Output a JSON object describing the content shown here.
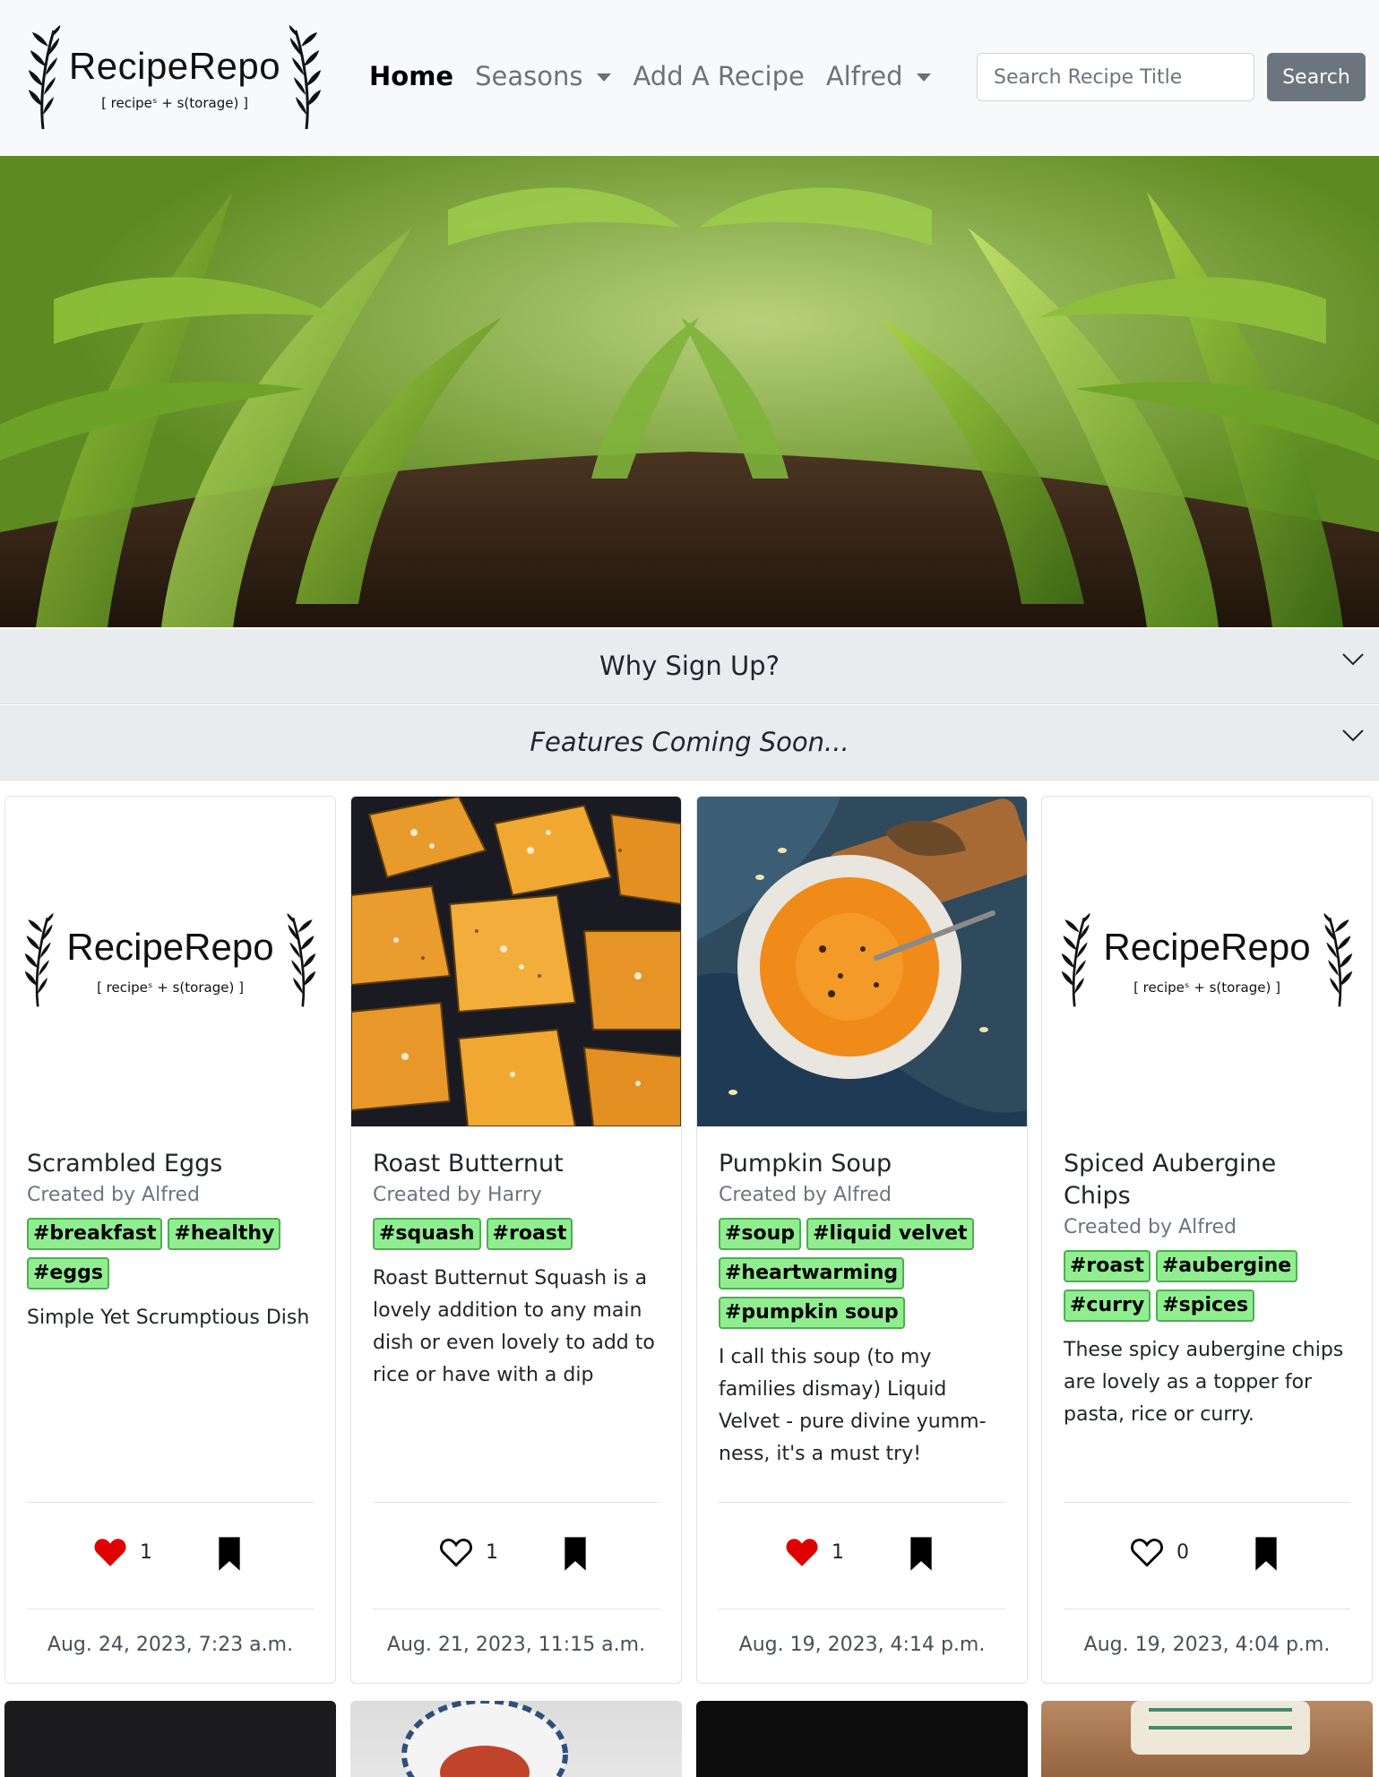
{
  "navbar": {
    "brand_title": "RecipeRepo",
    "brand_subtitle": "[ recipeˢ + s(torage) ]",
    "links": [
      {
        "label": "Home",
        "active": true
      },
      {
        "label": "Seasons",
        "dropdown": true
      },
      {
        "label": "Add A Recipe"
      },
      {
        "label": "Alfred",
        "dropdown": true
      }
    ],
    "search_placeholder": "Search Recipe Title",
    "search_button": "Search"
  },
  "accordion": [
    {
      "title": "Why Sign Up?"
    },
    {
      "title": "Features Coming Soon..."
    }
  ],
  "cards": [
    {
      "title": "Scrambled Eggs",
      "author": "Created by Alfred",
      "tags": [
        "#breakfast",
        "#healthy",
        "#eggs"
      ],
      "description": "Simple Yet Scrumptious Dish",
      "likes": "1",
      "liked": true,
      "date": "Aug. 24, 2023, 7:23 a.m.",
      "image": "logo-placeholder"
    },
    {
      "title": "Roast Butternut",
      "author": "Created by Harry",
      "tags": [
        "#squash",
        "#roast"
      ],
      "description": "Roast Butternut Squash is a lovely addition to any main dish or even lovely to add to rice or have with a dip",
      "likes": "1",
      "liked": false,
      "date": "Aug. 21, 2023, 11:15 a.m.",
      "image": "roast-butternut-photo"
    },
    {
      "title": "Pumpkin Soup",
      "author": "Created by Alfred",
      "tags": [
        "#soup",
        "#liquid velvet",
        "#heartwarming",
        "#pumpkin soup"
      ],
      "description": "I call this soup (to my families dismay) Liquid Velvet - pure divine yumm-ness, it's a must try!",
      "likes": "1",
      "liked": true,
      "date": "Aug. 19, 2023, 4:14 p.m.",
      "image": "pumpkin-soup-photo"
    },
    {
      "title": "Spiced Aubergine Chips",
      "author": "Created by Alfred",
      "tags": [
        "#roast",
        "#aubergine",
        "#curry",
        "#spices"
      ],
      "description": "These spicy aubergine chips are lovely as a topper for pasta, rice or curry.",
      "likes": "0",
      "liked": false,
      "date": "Aug. 19, 2023, 4:04 p.m.",
      "image": "logo-placeholder"
    }
  ],
  "colors": {
    "tag_bg": "#90ee90",
    "tag_border": "#4caf50",
    "like_red": "#e00000",
    "search_button": "#6c757d",
    "navbar_bg": "#f8f9fa",
    "accordion_bg": "#e9ecef"
  }
}
